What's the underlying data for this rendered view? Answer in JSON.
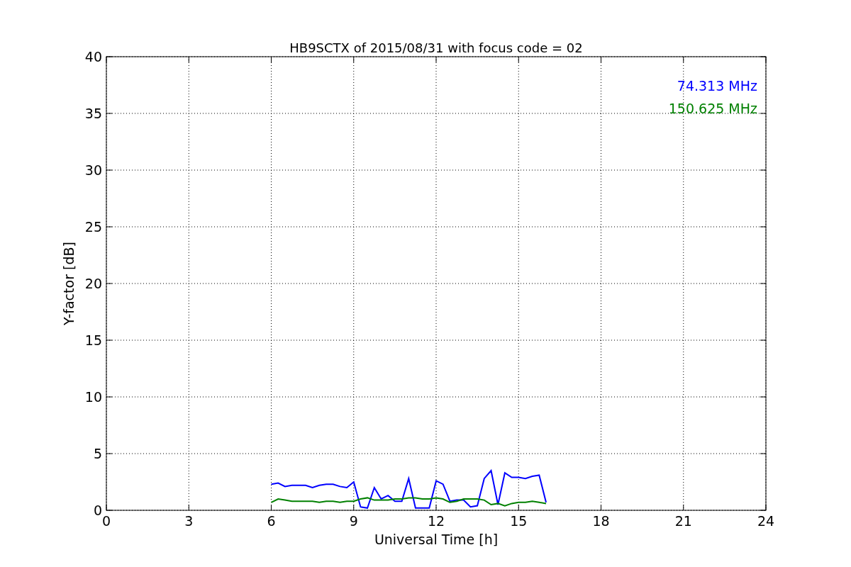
{
  "chart_data": {
    "type": "line",
    "title": "HB9SCTX of 2015/08/31 with focus code = 02",
    "xlabel": "Universal Time [h]",
    "ylabel": "Y-factor [dB]",
    "x": [
      6,
      6.25,
      6.5,
      6.75,
      7,
      7.25,
      7.5,
      7.75,
      8,
      8.25,
      8.5,
      8.75,
      9,
      9.25,
      9.5,
      9.75,
      10,
      10.25,
      10.5,
      10.75,
      11,
      11.25,
      11.5,
      11.75,
      12,
      12.25,
      12.5,
      12.75,
      13,
      13.25,
      13.5,
      13.75,
      14,
      14.25,
      14.5,
      14.75,
      15,
      15.25,
      15.5,
      15.75,
      16
    ],
    "series": [
      {
        "name": "74.313 MHz",
        "color": "#0000ff",
        "values": [
          2.3,
          2.4,
          2.1,
          2.2,
          2.2,
          2.2,
          2.0,
          2.2,
          2.3,
          2.3,
          2.1,
          2.0,
          2.5,
          0.3,
          0.2,
          2.0,
          1.0,
          1.3,
          0.8,
          0.8,
          2.8,
          0.2,
          0.2,
          0.2,
          2.6,
          2.3,
          0.8,
          0.9,
          0.9,
          0.3,
          0.4,
          2.8,
          3.5,
          0.5,
          3.3,
          2.9,
          2.9,
          2.8,
          3.0,
          3.1,
          0.7
        ]
      },
      {
        "name": "150.625 MHz",
        "color": "#008000",
        "values": [
          0.7,
          1.0,
          0.9,
          0.8,
          0.8,
          0.8,
          0.8,
          0.7,
          0.8,
          0.8,
          0.7,
          0.8,
          0.8,
          1.0,
          1.1,
          0.9,
          0.9,
          0.9,
          1.0,
          1.0,
          1.1,
          1.1,
          1.0,
          1.0,
          1.1,
          1.0,
          0.7,
          0.8,
          1.0,
          1.0,
          1.0,
          0.9,
          0.5,
          0.6,
          0.4,
          0.6,
          0.7,
          0.7,
          0.8,
          0.7,
          0.6
        ]
      }
    ],
    "grid": true,
    "xlim": [
      0,
      24
    ],
    "ylim": [
      0,
      40
    ],
    "xticks": [
      0,
      3,
      6,
      9,
      12,
      15,
      18,
      21,
      24
    ],
    "yticks": [
      0,
      5,
      10,
      15,
      20,
      25,
      30,
      35,
      40
    ]
  }
}
